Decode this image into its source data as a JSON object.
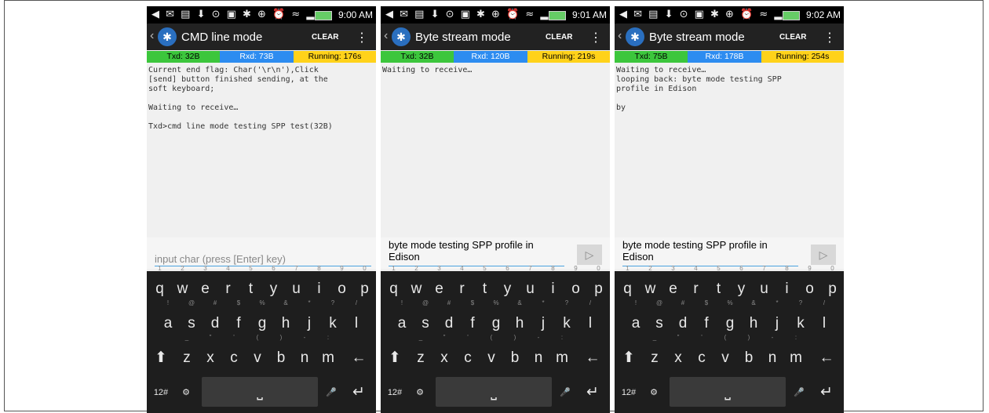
{
  "screens": [
    {
      "time": "9:00 AM",
      "title": "CMD line mode",
      "clear_label": "CLEAR",
      "menu_icon": "overflow-menu-icon",
      "txd": "Txd: 32B",
      "rxd": "Rxd: 73B",
      "running": "Running: 176s",
      "log": "Current end flag: Char('\\r\\n'),Click\n[send] button finished sending, at the\nsoft keyboard;\n\nWaiting to receive…\n\nTxd>cmd line mode testing SPP test(32B)",
      "input_value": "",
      "input_placeholder": "input char (press [Enter] key)",
      "show_send": false
    },
    {
      "time": "9:01 AM",
      "title": "Byte stream mode",
      "clear_label": "CLEAR",
      "menu_icon": "overflow-menu-icon",
      "txd": "Txd: 32B",
      "rxd": "Rxd: 120B",
      "running": "Running: 219s",
      "log": "Waiting to receive…",
      "input_value": "byte mode testing SPP profile in Edison",
      "input_placeholder": "",
      "show_send": true
    },
    {
      "time": "9:02 AM",
      "title": "Byte stream mode",
      "clear_label": "CLEAR",
      "menu_icon": "overflow-menu-icon",
      "txd": "Txd: 75B",
      "rxd": "Rxd: 178B",
      "running": "Running: 254s",
      "log": "Waiting to receive…\nlooping back: byte mode testing SPP\nprofile in Edison\n\nby",
      "input_value": "byte mode testing SPP profile in Edison",
      "input_placeholder": "",
      "show_send": true
    }
  ],
  "keyboard": {
    "row1": [
      "q",
      "w",
      "e",
      "r",
      "t",
      "y",
      "u",
      "i",
      "o",
      "p"
    ],
    "row1_hints": [
      "1",
      "2",
      "3",
      "4",
      "5",
      "6",
      "7",
      "8",
      "9",
      "0"
    ],
    "row2": [
      "a",
      "s",
      "d",
      "f",
      "g",
      "h",
      "j",
      "k",
      "l"
    ],
    "row2_hints": [
      "!",
      "@",
      "#",
      "$",
      "%",
      "&",
      "*",
      "?",
      "/"
    ],
    "row3": [
      "z",
      "x",
      "c",
      "v",
      "b",
      "n",
      "m"
    ],
    "row3_hints": [
      "_",
      "\"",
      "'",
      "(",
      ")",
      "-",
      ":"
    ],
    "shift_icon": "shift-arrow-icon",
    "backspace_icon": "backspace-icon",
    "symbols_label": "12#",
    "enter_icon": "enter-icon",
    "mic_icon": "microphone-icon",
    "settings_icon": "settings-gear-icon"
  }
}
